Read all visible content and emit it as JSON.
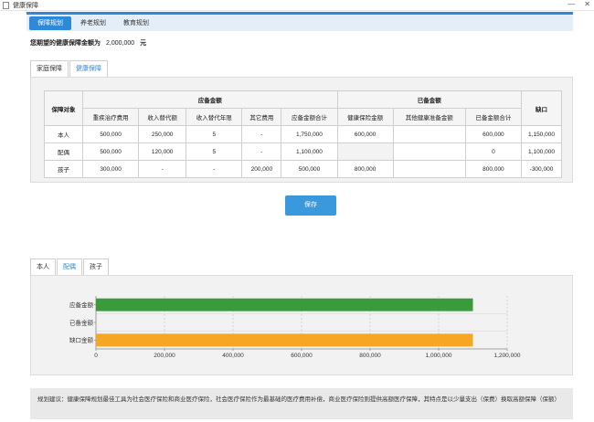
{
  "window": {
    "title": "健康保障",
    "minimize": "—",
    "close": "✕"
  },
  "top_tabs": [
    {
      "label": "保障规划",
      "active": true
    },
    {
      "label": "养老规划",
      "active": false
    },
    {
      "label": "教育规划",
      "active": false
    }
  ],
  "expectation": {
    "label": "您期望的健康保障金额为",
    "value": "2,000,000",
    "unit": "元"
  },
  "sub_tabs": [
    {
      "label": "家庭保障",
      "active": false
    },
    {
      "label": "健康保障",
      "active": true
    }
  ],
  "table": {
    "col_target": "保障对象",
    "group_required": "应备金额",
    "group_existing": "已备金额",
    "col_gap": "缺口",
    "required_cols": [
      "重疾治疗费用",
      "收入替代额",
      "收入替代年限",
      "其它费用",
      "应备金额合计"
    ],
    "existing_cols": [
      "健康保险金额",
      "其他健康准备金额",
      "已备金额合计"
    ],
    "rows": [
      {
        "name": "本人",
        "cells": [
          "500,000",
          "250,000",
          "5",
          "-",
          "1,750,000",
          "600,000",
          "",
          "600,000",
          "1,150,000"
        ]
      },
      {
        "name": "配偶",
        "cells": [
          "500,000",
          "120,000",
          "5",
          "-",
          "1,100,000",
          "",
          "",
          "0",
          "1,100,000"
        ]
      },
      {
        "name": "孩子",
        "cells": [
          "300,000",
          "-",
          "-",
          "200,000",
          "500,000",
          "800,000",
          "",
          "800,000",
          "-300,000"
        ]
      }
    ]
  },
  "save_label": "保存",
  "person_tabs": [
    {
      "label": "本人",
      "active": false
    },
    {
      "label": "配偶",
      "active": true
    },
    {
      "label": "孩子",
      "active": false
    }
  ],
  "chart_data": {
    "type": "bar",
    "orientation": "horizontal",
    "categories": [
      "应备金额",
      "已备金额",
      "缺口金额"
    ],
    "values": [
      1100000,
      0,
      1100000
    ],
    "colors": [
      "#3a9b3a",
      "#cccccc",
      "#f5a623"
    ],
    "xlim": [
      0,
      1200000
    ],
    "xticks": [
      0,
      200000,
      400000,
      600000,
      800000,
      1000000,
      1200000
    ],
    "xtick_labels": [
      "0",
      "200,000",
      "400,000",
      "600,000",
      "800,000",
      "1,000,000",
      "1,200,000"
    ],
    "grid": true
  },
  "advice": "规划建议：健康保障规划最佳工具为社会医疗保险和商业医疗保险，社会医疗保险作为最基础的医疗费用补偿，商业医疗保险则提供高额医疗保障，其特点是以少量支出（保费）换取高额保障（保额）"
}
